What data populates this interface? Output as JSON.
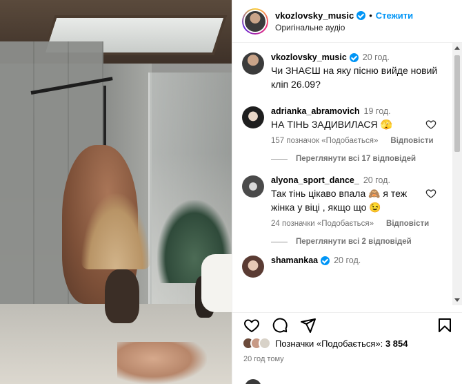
{
  "header": {
    "username": "vkozlovsky_music",
    "follow_label": "Стежити",
    "separator": "•",
    "audio_label": "Оригінальне аудіо"
  },
  "caption": {
    "username": "vkozlovsky_music",
    "time": "20 год.",
    "text": "Чи ЗНАЄШ на яку пісню вийде новий кліп 26.09?"
  },
  "comments": [
    {
      "username": "adrianka_abramovich",
      "time": "19 год.",
      "text": "НА ТІНЬ ЗАДИВИЛАСЯ 🫣",
      "likes": "157 позначок «Подобається»",
      "reply_label": "Відповісти",
      "view_replies": "Переглянути всі 17 відповідей"
    },
    {
      "username": "alyona_sport_dance_",
      "time": "20 год.",
      "text": "Так тінь цікаво впала 🙈 я теж жінка у віці , якщо що 😉",
      "likes": "24 позначки «Подобається»",
      "reply_label": "Відповісти",
      "view_replies": "Переглянути всі 2 відповідей"
    },
    {
      "username": "shamankaa",
      "time": "20 год."
    }
  ],
  "actions": {
    "icons": [
      "heart-icon",
      "comment-icon",
      "share-icon",
      "bookmark-icon"
    ]
  },
  "likes": {
    "label": "Позначки «Подобається»:",
    "count": "3 854"
  },
  "posted_ago": "20 год тому",
  "colors": {
    "accent": "#0095f6",
    "muted": "#737373",
    "border": "#efefef"
  }
}
